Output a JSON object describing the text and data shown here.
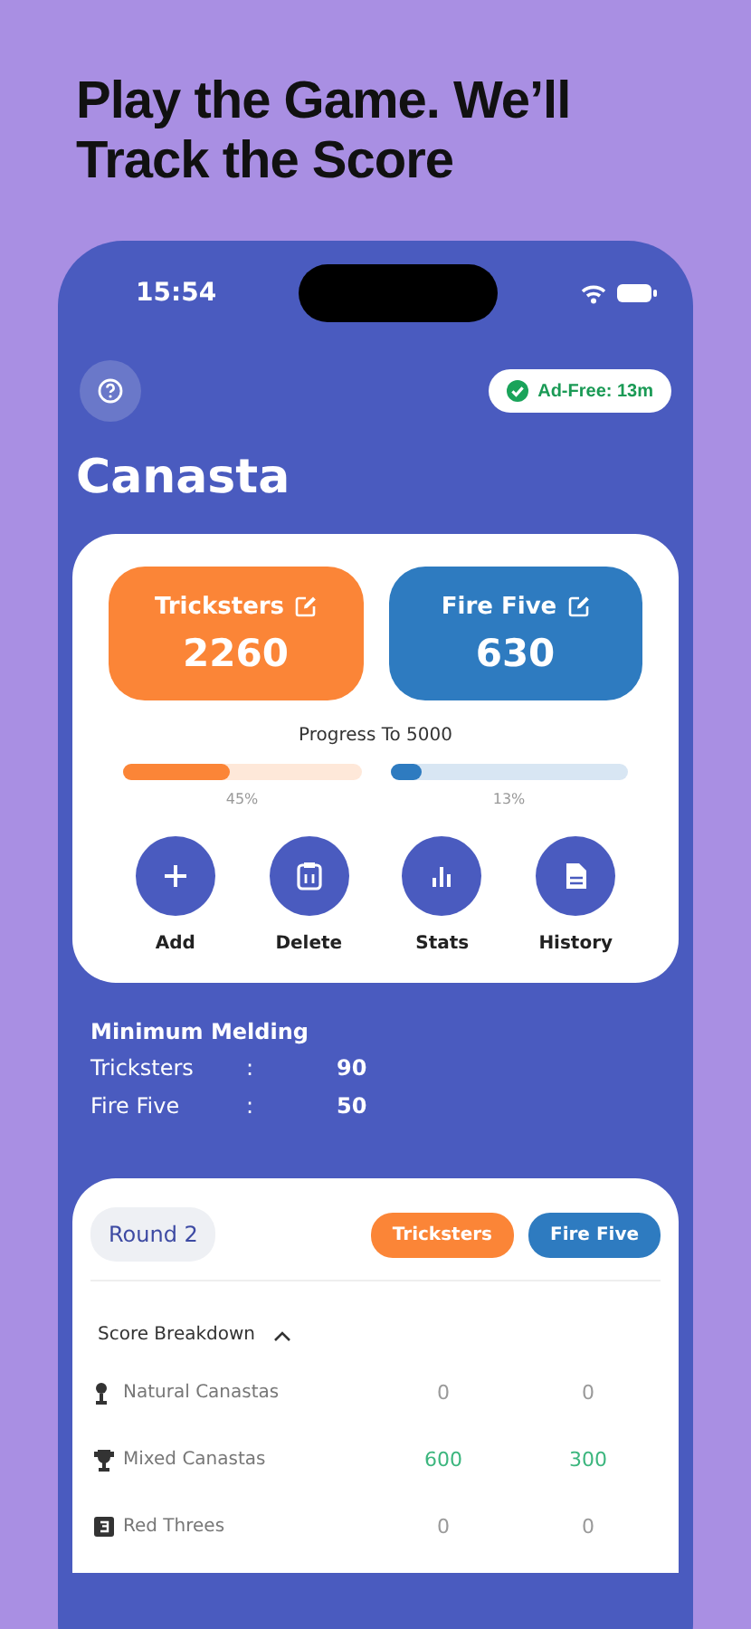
{
  "headline": "Play the Game. We’ll Track the Score",
  "status_bar": {
    "time": "15:54"
  },
  "ad_badge": {
    "label": "Ad-Free: 13m"
  },
  "title": "Canasta",
  "teams": [
    {
      "name": "Tricksters",
      "score": "2260",
      "color": "#fb8537",
      "level": 0.45,
      "percent": "45%"
    },
    {
      "name": "Fire Five",
      "score": "630",
      "color": "#2e7bc0",
      "level": 0.13,
      "percent": "13%"
    }
  ],
  "progress_label": "Progress To 5000",
  "actions": [
    {
      "label": "Add",
      "kind": "add"
    },
    {
      "label": "Delete",
      "kind": "delete"
    },
    {
      "label": "Stats",
      "kind": "stats"
    },
    {
      "label": "History",
      "kind": "history"
    }
  ],
  "minimum_melding": {
    "title": "Minimum Melding",
    "rows": [
      {
        "team": "Tricksters",
        "separator": ":",
        "value": "90"
      },
      {
        "team": "Fire Five",
        "separator": ":",
        "value": "50"
      }
    ]
  },
  "round": {
    "label": "Round 2"
  },
  "team_tabs": [
    {
      "label": "Tricksters",
      "color": "#fb8537"
    },
    {
      "label": "Fire Five",
      "color": "#2e7bc0"
    }
  ],
  "breakdown": {
    "title": "Score Breakdown",
    "expanded": true,
    "rows": [
      {
        "kind": "natural",
        "label": "Natural Canastas",
        "values": [
          {
            "text": "0",
            "color": "#9a9a9a"
          },
          {
            "text": "0",
            "color": "#9a9a9a"
          }
        ]
      },
      {
        "kind": "mixed",
        "label": "Mixed Canastas",
        "values": [
          {
            "text": "600",
            "color": "#3cb67e"
          },
          {
            "text": "300",
            "color": "#3cb67e"
          }
        ]
      },
      {
        "kind": "threes",
        "label": "Red Threes",
        "values": [
          {
            "text": "0",
            "color": "#9a9a9a"
          },
          {
            "text": "0",
            "color": "#9a9a9a"
          }
        ]
      }
    ]
  }
}
